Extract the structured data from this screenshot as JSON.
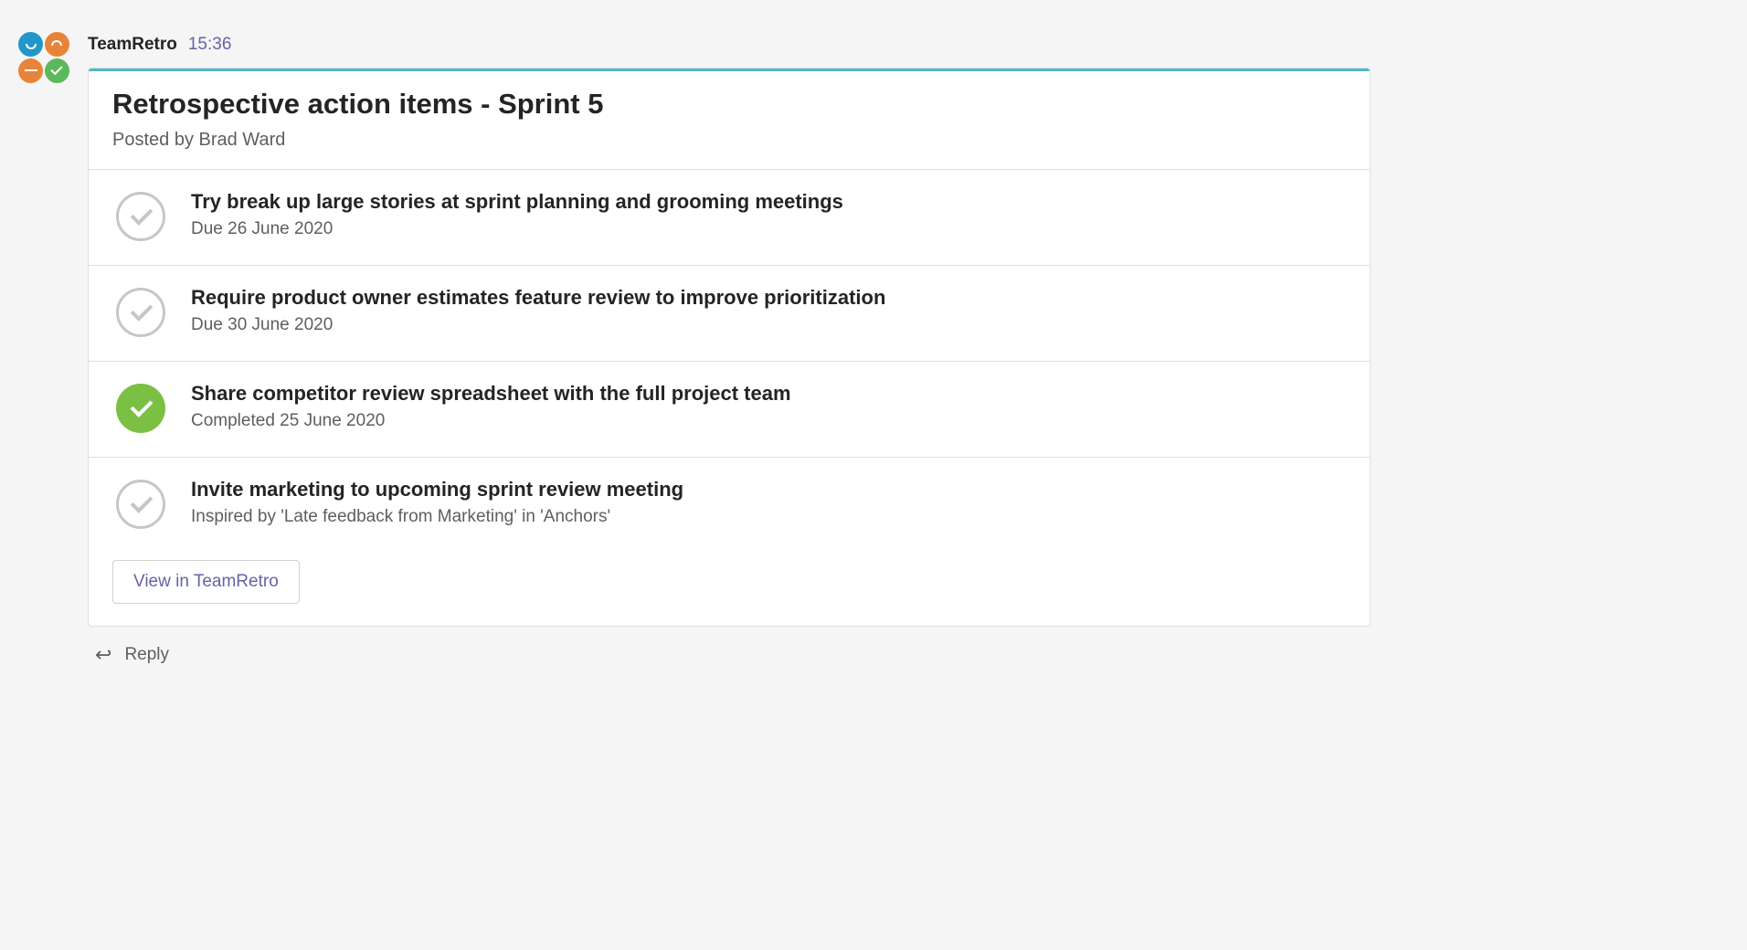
{
  "app": {
    "name": "TeamRetro",
    "timestamp": "15:36"
  },
  "card": {
    "title": "Retrospective action items - Sprint 5",
    "postedBy": "Posted by Brad Ward",
    "items": [
      {
        "title": "Try break up large stories at sprint planning and grooming meetings",
        "meta": "Due 26 June 2020",
        "status": "pending"
      },
      {
        "title": "Require product owner estimates feature review to improve prioritization",
        "meta": "Due 30 June 2020",
        "status": "pending"
      },
      {
        "title": "Share competitor review spreadsheet with the full project team",
        "meta": "Completed 25 June 2020",
        "status": "completed"
      },
      {
        "title": "Invite marketing to upcoming sprint review meeting",
        "meta": "Inspired by 'Late feedback from Marketing' in 'Anchors'",
        "status": "pending"
      }
    ],
    "viewButton": "View in TeamRetro"
  },
  "reply": {
    "label": "Reply"
  }
}
